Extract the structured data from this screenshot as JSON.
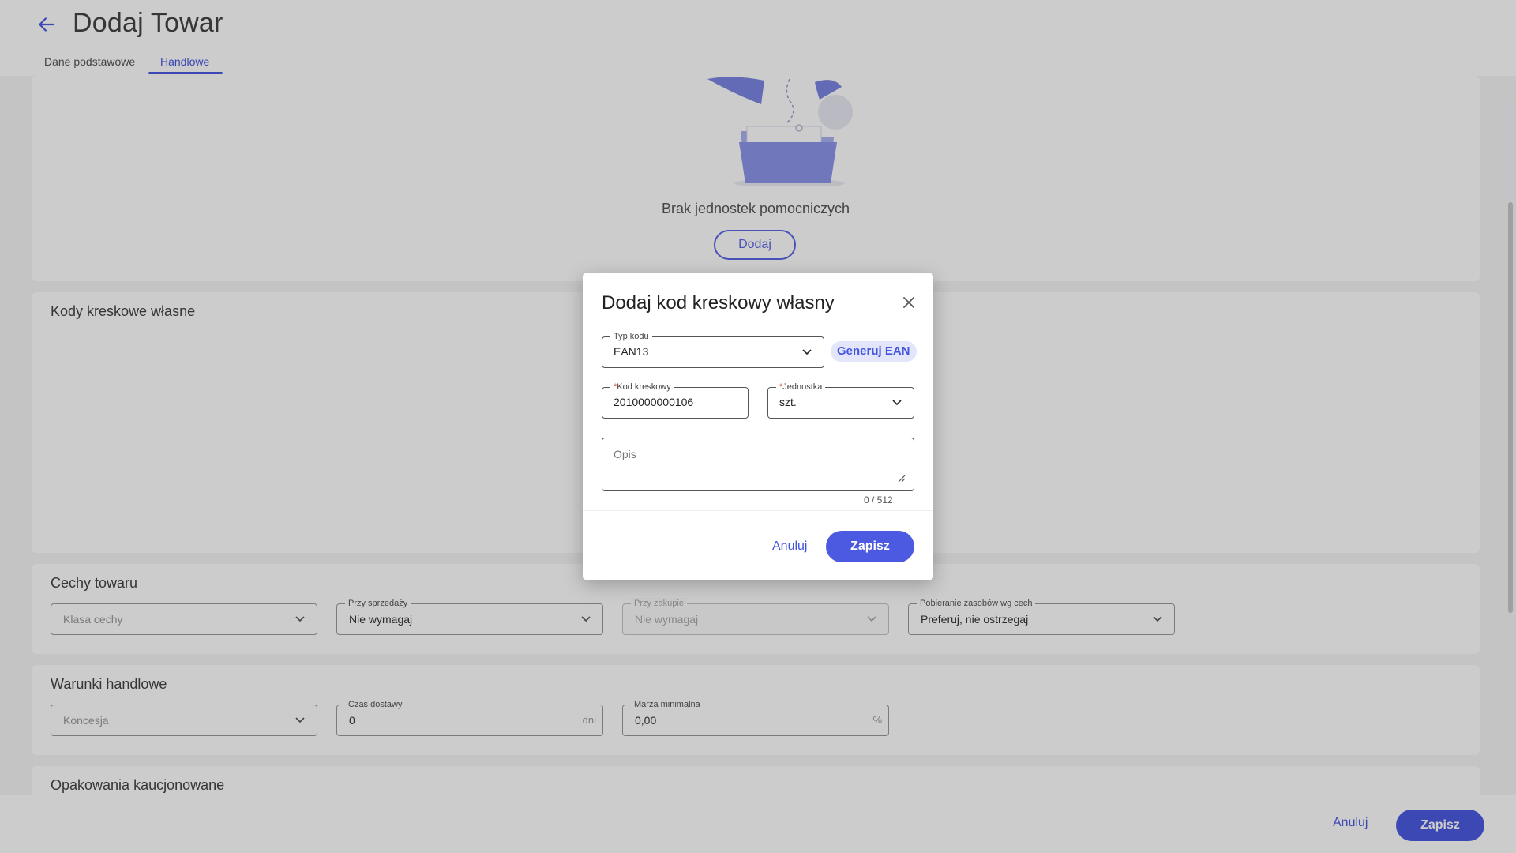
{
  "header": {
    "title": "Dodaj Towar",
    "tabs": [
      {
        "label": "Dane podstawowe",
        "active": false
      },
      {
        "label": "Handlowe",
        "active": true
      }
    ]
  },
  "units_section": {
    "empty_text": "Brak jednostek pomocniczych",
    "add_label": "Dodaj"
  },
  "barcodes_section": {
    "title": "Kody kreskowe własne"
  },
  "features_section": {
    "title": "Cechy towaru",
    "fields": [
      {
        "label": "",
        "value": "Klasa cechy",
        "is_placeholder": true
      },
      {
        "label": "Przy sprzedaży",
        "value": "Nie wymagaj"
      },
      {
        "label": "Przy zakupie",
        "value": "Nie wymagaj",
        "disabled": true
      },
      {
        "label": "Pobieranie zasobów wg cech",
        "value": "Preferuj, nie ostrzegaj"
      }
    ]
  },
  "trade_section": {
    "title": "Warunki handlowe",
    "concession": {
      "value": "Koncesja"
    },
    "delivery": {
      "label": "Czas dostawy",
      "value": "0",
      "suffix": "dni"
    },
    "margin": {
      "label": "Marża minimalna",
      "value": "0,00",
      "suffix": "%"
    }
  },
  "deposit_section": {
    "title": "Opakowania kaucjonowane"
  },
  "footer": {
    "cancel_label": "Anuluj",
    "save_label": "Zapisz"
  },
  "modal": {
    "title": "Dodaj kod kreskowy własny",
    "code_type": {
      "label": "Typ kodu",
      "value": "EAN13"
    },
    "generate_label": "Generuj EAN",
    "barcode": {
      "required_mark": "*",
      "label": "Kod kreskowy",
      "value": "2010000000106"
    },
    "unit": {
      "required_mark": "*",
      "label": "Jednostka",
      "value": "szt."
    },
    "description": {
      "placeholder": "Opis",
      "counter": "0  / 512"
    },
    "cancel_label": "Anuluj",
    "save_label": "Zapisz"
  },
  "colors": {
    "accent": "#4b5ae0",
    "chip_bg": "#e3e5fb",
    "required": "#d32f2f"
  }
}
